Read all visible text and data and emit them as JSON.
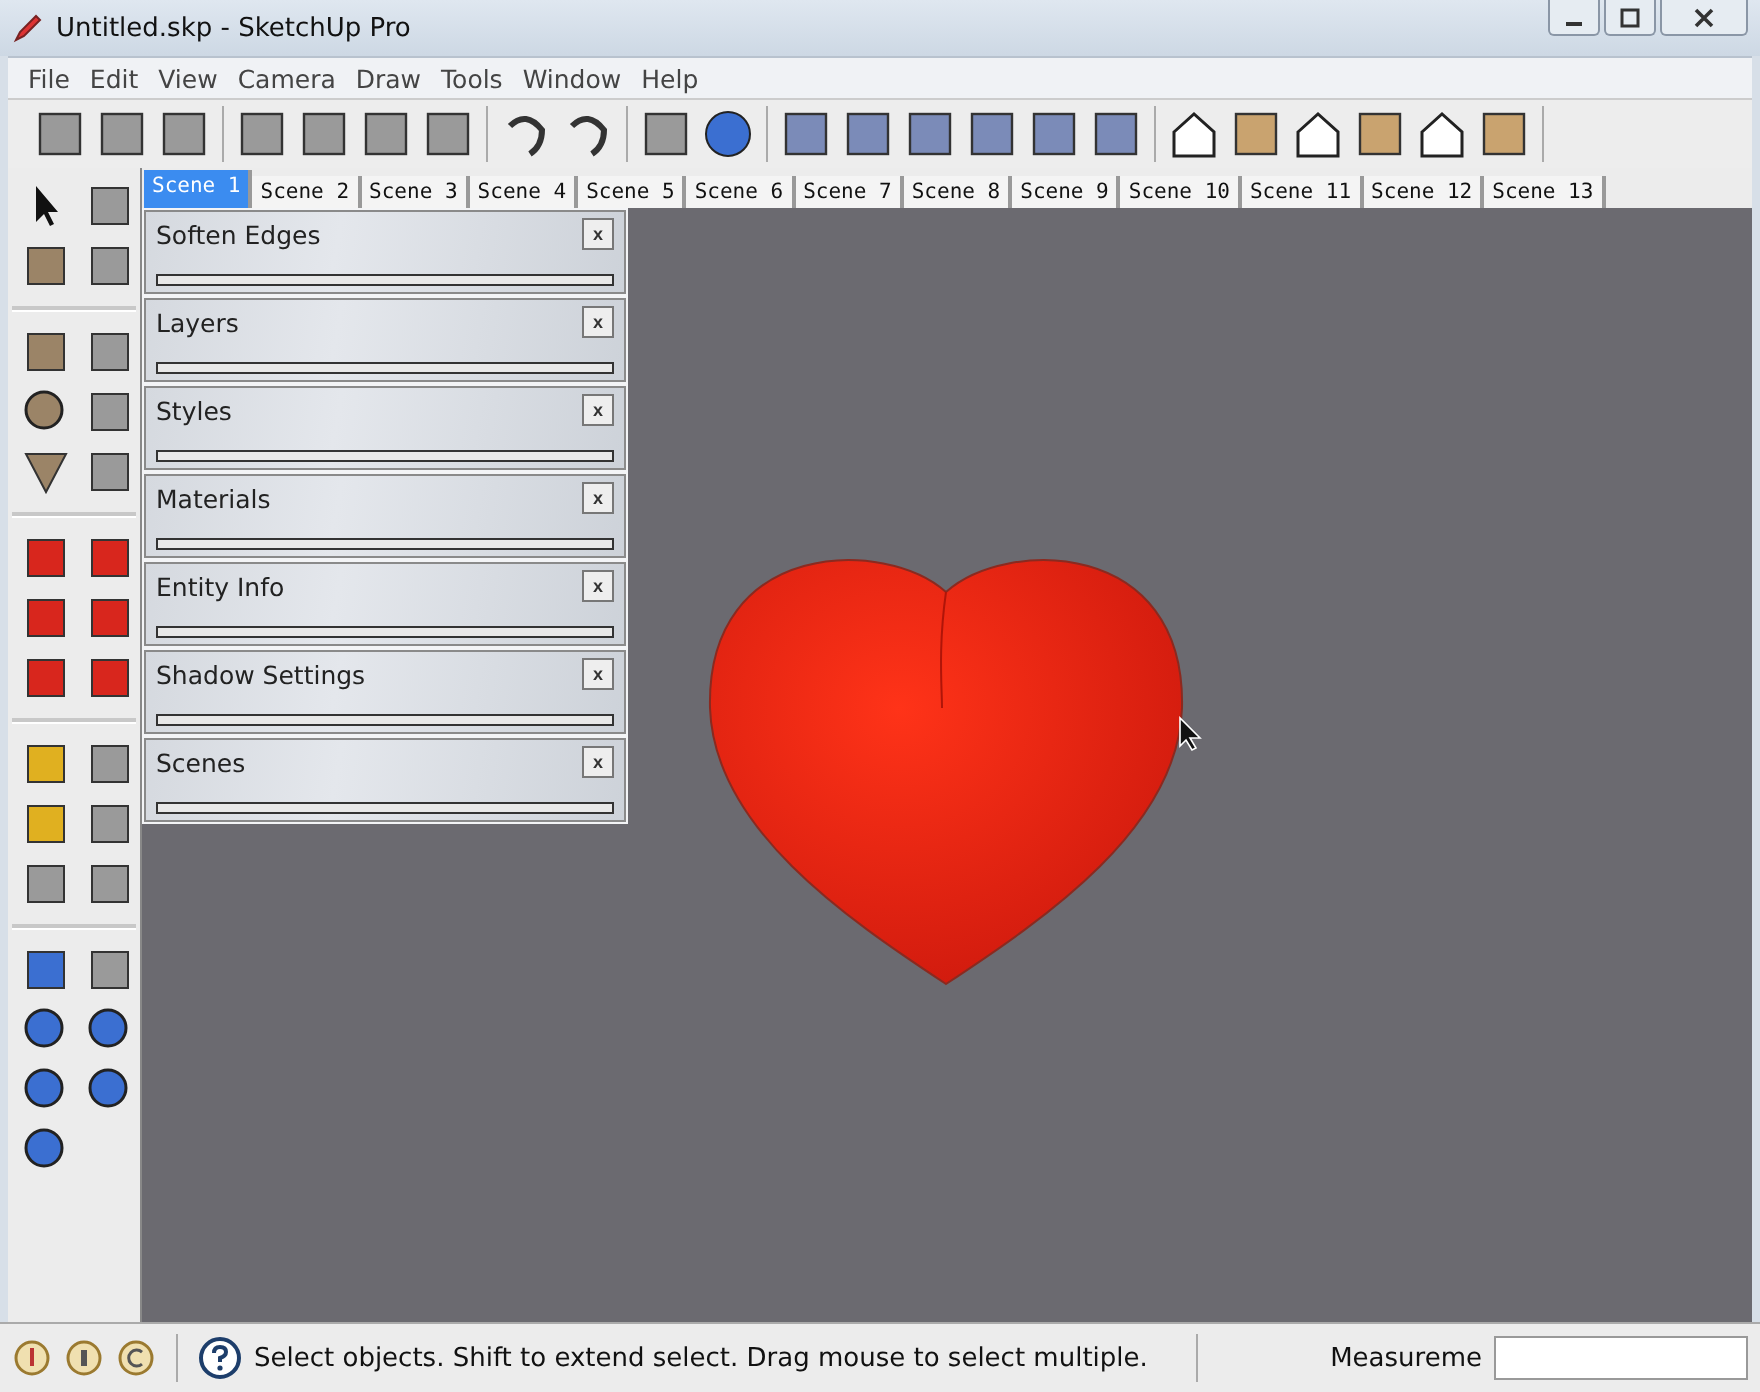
{
  "window": {
    "title": "Untitled.skp - SketchUp Pro"
  },
  "menu": [
    "File",
    "Edit",
    "View",
    "Camera",
    "Draw",
    "Tools",
    "Window",
    "Help"
  ],
  "scene_tabs": [
    {
      "label": "Scene 1",
      "selected": true
    },
    {
      "label": "Scene 2",
      "selected": false
    },
    {
      "label": "Scene 3",
      "selected": false
    },
    {
      "label": "Scene 4",
      "selected": false
    },
    {
      "label": "Scene 5",
      "selected": false
    },
    {
      "label": "Scene 6",
      "selected": false
    },
    {
      "label": "Scene 7",
      "selected": false
    },
    {
      "label": "Scene 8",
      "selected": false
    },
    {
      "label": "Scene 9",
      "selected": false
    },
    {
      "label": "Scene 10",
      "selected": false
    },
    {
      "label": "Scene 11",
      "selected": false
    },
    {
      "label": "Scene 12",
      "selected": false
    },
    {
      "label": "Scene 13",
      "selected": false
    }
  ],
  "panels": [
    {
      "title": "Soften Edges",
      "close": "x"
    },
    {
      "title": "Layers",
      "close": "x"
    },
    {
      "title": "Styles",
      "close": "x"
    },
    {
      "title": "Materials",
      "close": "x"
    },
    {
      "title": "Entity Info",
      "close": "x"
    },
    {
      "title": "Shadow Settings",
      "close": "x"
    },
    {
      "title": "Scenes",
      "close": "x"
    }
  ],
  "status_bar": {
    "hint": "Select objects. Shift to extend select. Drag mouse to select multiple.",
    "measurements_label": "Measureme"
  }
}
